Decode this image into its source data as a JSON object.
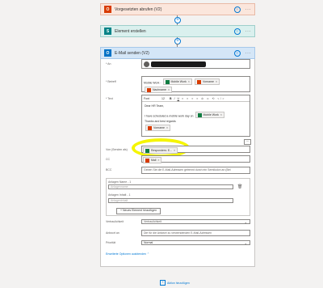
{
  "top_step": {
    "title": "Vorgesetzten abrufen (V2)"
  },
  "create_step": {
    "title": "Element erstellen"
  },
  "mail_step": {
    "title": "E-Mail senden (V2)",
    "to_label": "* An",
    "subject_label": "* Betreff",
    "subject_text": "Mobile Work -",
    "subject_tokens": [
      "Mobile Work",
      "Vorname",
      "Nachname"
    ],
    "body_label": "* Text",
    "toolbar": {
      "font": "Font",
      "size": "12",
      "buttons": [
        "B",
        "I",
        "U"
      ]
    },
    "body_line1": "Dear HR Team,",
    "body_line2": "I have scheduled a mobile work day on",
    "body_token_date": "Mobile Work",
    "body_line3": "Thanks and best regards",
    "body_token_name": "Vorname",
    "from_label": "Von (Senden als)",
    "from_token": "Responders: E...",
    "cc_label": "CC",
    "cc_token": "Mail",
    "bcc_label": "BCC",
    "bcc_placeholder": "Geben Sie die E-Mail-Adressen getrennt durch ein Semikolon an (Bei",
    "attach_name_label": "Anlagen Name - 1",
    "attach_name_placeholder": "Anlagenname",
    "attach_content_label": "Anlagen Inhalt - 1",
    "attach_content_placeholder": "Anlageninhalt",
    "add_item": "Neues Element hinzufügen",
    "sensitivity_label": "Vertraulichkeit",
    "sensitivity_value": "Vertraulichkeit",
    "reply_label": "Antwort an",
    "reply_placeholder": "Die für die Antwort zu verwendenden E-Mail-Adressen",
    "priority_label": "Priorität",
    "priority_value": "Normal",
    "advanced": "Erweiterte Optionen ausblenden"
  },
  "add_action": "Aktion hinzufügen",
  "colors": {
    "highlight": "#f5f500",
    "accent": "#0078d4"
  }
}
